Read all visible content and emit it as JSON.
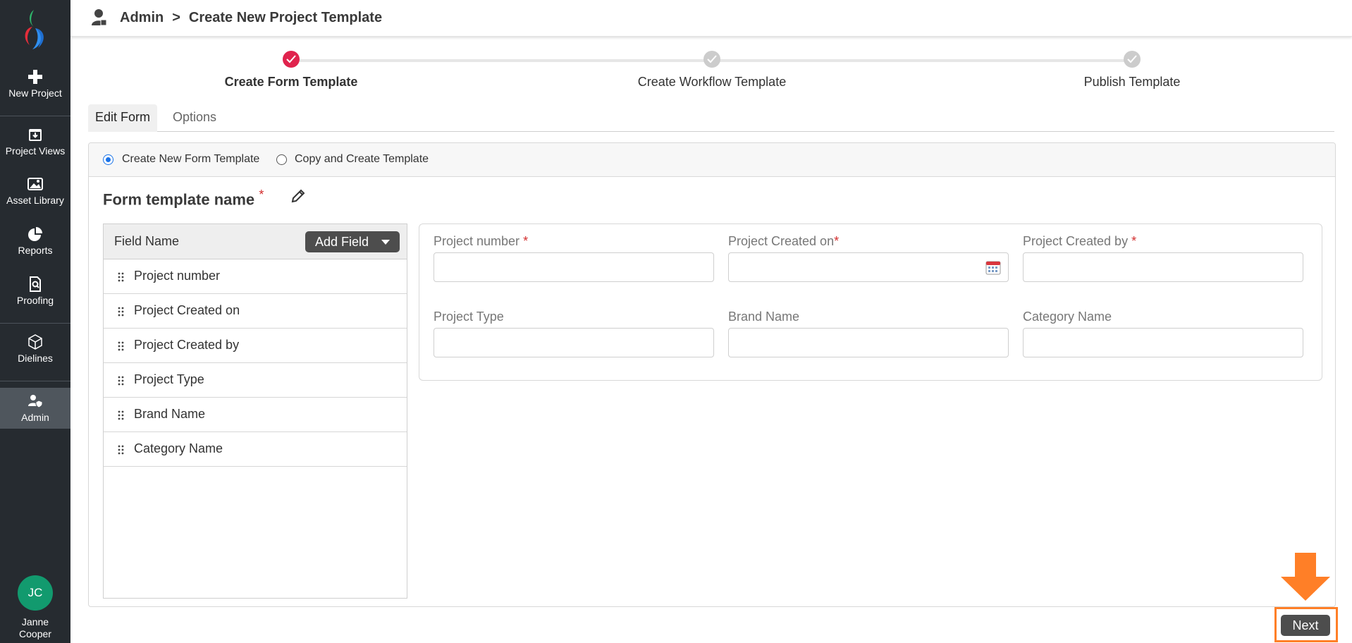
{
  "sidebar": {
    "items": [
      {
        "label": "New Project",
        "icon": "plus-icon"
      },
      {
        "label": "Project Views",
        "icon": "download-box-icon"
      },
      {
        "label": "Asset Library",
        "icon": "image-icon"
      },
      {
        "label": "Reports",
        "icon": "pie-chart-icon"
      },
      {
        "label": "Proofing",
        "icon": "document-search-icon"
      },
      {
        "label": "Dielines",
        "icon": "box-icon"
      },
      {
        "label": "Admin",
        "icon": "user-shield-icon"
      }
    ],
    "user": {
      "initials": "JC",
      "name": "Janne Cooper"
    },
    "colors": {
      "bg": "#262b30",
      "active": "#4f565d",
      "avatar": "#129a6e"
    }
  },
  "header": {
    "section": "Admin",
    "separator": ">",
    "page": "Create New Project Template"
  },
  "stepper": {
    "steps": [
      {
        "label": "Create Form Template",
        "state": "done"
      },
      {
        "label": "Create Workflow Template",
        "state": "pending"
      },
      {
        "label": "Publish Template",
        "state": "pending"
      }
    ],
    "colors": {
      "done": "#e0234d",
      "pending": "#cccccc"
    }
  },
  "tabs": [
    {
      "label": "Edit Form",
      "active": true
    },
    {
      "label": "Options",
      "active": false
    }
  ],
  "template_mode": {
    "options": [
      {
        "label": "Create New Form Template",
        "checked": true
      },
      {
        "label": "Copy and Create Template",
        "checked": false
      }
    ]
  },
  "form": {
    "title": "Form template name",
    "required_mark": "*"
  },
  "field_list": {
    "header": "Field Name",
    "add_button": "Add Field",
    "fields": [
      "Project number",
      "Project Created on",
      "Project Created by",
      "Project Type",
      "Brand Name",
      "Category Name"
    ]
  },
  "form_fields": [
    {
      "label": "Project number",
      "required": true,
      "value": ""
    },
    {
      "label": "Project Created on",
      "required": true,
      "value": ""
    },
    {
      "label": "Project Created by",
      "required": true,
      "value": ""
    },
    {
      "label": "Project Type",
      "required": false,
      "value": ""
    },
    {
      "label": "Brand Name",
      "required": false,
      "value": ""
    },
    {
      "label": "Category Name",
      "required": false,
      "value": ""
    }
  ],
  "footer": {
    "next_label": "Next",
    "highlight_color": "#ff7f27"
  }
}
